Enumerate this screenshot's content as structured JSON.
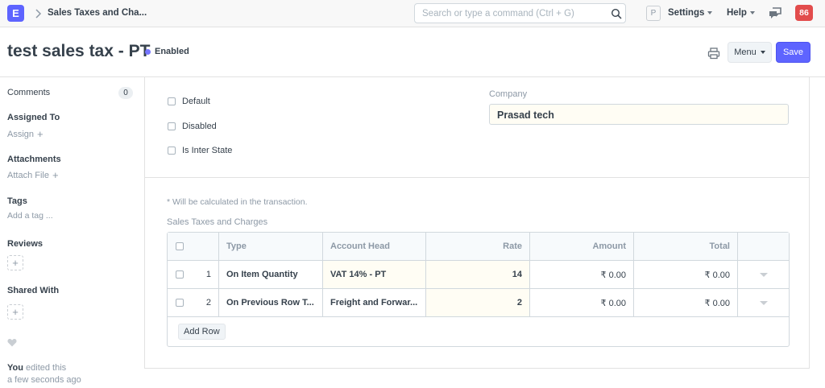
{
  "navbar": {
    "logo_letter": "E",
    "breadcrumb": "Sales Taxes and Cha...",
    "search_placeholder": "Search or type a command (Ctrl + G)",
    "user_initial": "P",
    "settings_label": "Settings",
    "help_label": "Help",
    "notification_count": "86"
  },
  "page": {
    "title": "test sales tax - PT",
    "status": "Enabled",
    "menu_label": "Menu",
    "save_label": "Save"
  },
  "sidebar": {
    "comments_label": "Comments",
    "comments_count": "0",
    "assigned_to_label": "Assigned To",
    "assign_label": "Assign",
    "attachments_label": "Attachments",
    "attach_label": "Attach File",
    "tags_label": "Tags",
    "add_tag_label": "Add a tag ...",
    "reviews_label": "Reviews",
    "shared_with_label": "Shared With",
    "edited_user": "You",
    "edited_text": "edited this",
    "edited_time": "a few seconds ago"
  },
  "form": {
    "checkboxes": [
      "Default",
      "Disabled",
      "Is Inter State"
    ],
    "company_label": "Company",
    "company_value": "Prasad tech",
    "note": "* Will be calculated in the transaction.",
    "grid_label": "Sales Taxes and Charges",
    "grid_headers": [
      "Type",
      "Account Head",
      "Rate",
      "Amount",
      "Total"
    ],
    "rows": [
      {
        "idx": "1",
        "type": "On Item Quantity",
        "account": "VAT 14% - PT",
        "rate": "14",
        "amount": "₹ 0.00",
        "total": "₹ 0.00"
      },
      {
        "idx": "2",
        "type": "On Previous Row T...",
        "account": "Freight and Forwar...",
        "rate": "2",
        "amount": "₹ 0.00",
        "total": "₹ 0.00"
      }
    ],
    "add_row_label": "Add Row"
  },
  "colors": {
    "primary": "#5e64ff",
    "notification": "#e24c4c",
    "highlight": "#fffdf4"
  }
}
